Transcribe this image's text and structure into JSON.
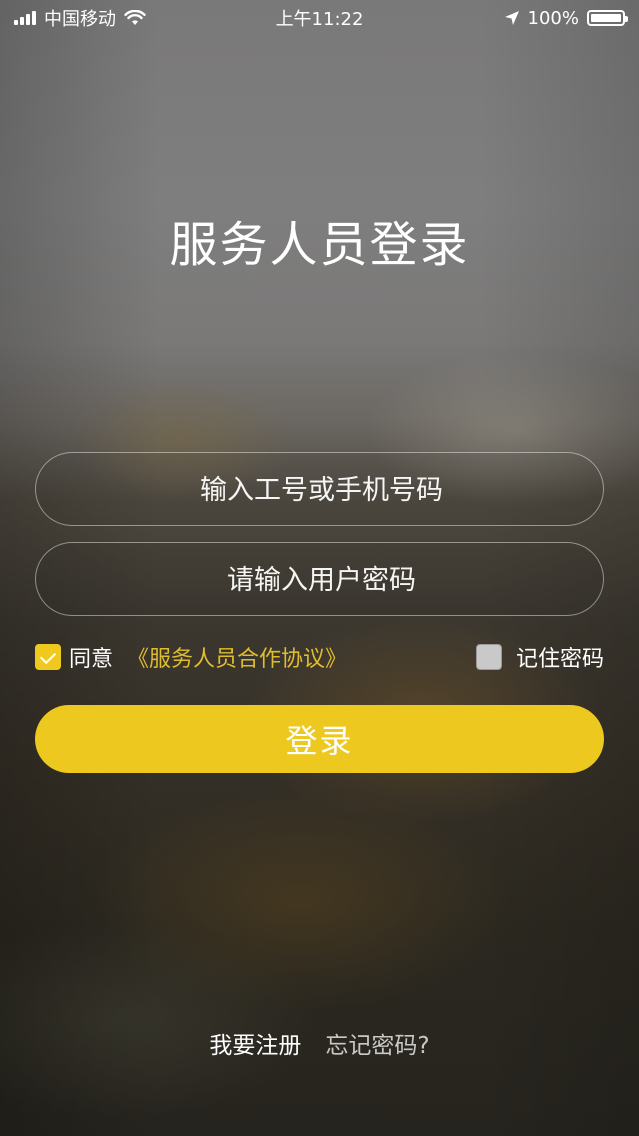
{
  "status_bar": {
    "carrier": "中国移动",
    "time": "上午11:22",
    "battery": "100%",
    "signal_icon": "signal-bars-icon",
    "wifi_icon": "wifi-icon",
    "location_icon": "location-arrow-icon",
    "battery_icon": "battery-icon",
    "battery_level": 1.0
  },
  "title": "服务人员登录",
  "form": {
    "username": {
      "placeholder": "输入工号或手机号码",
      "value": ""
    },
    "password": {
      "placeholder": "请输入用户密码",
      "value": ""
    },
    "agree": {
      "checked": true,
      "label": "同意",
      "link": "《服务人员合作协议》"
    },
    "remember": {
      "checked": false,
      "label": "记住密码"
    },
    "login_label": "登录"
  },
  "footer": {
    "register": "我要注册",
    "forgot": "忘记密码?"
  },
  "colors": {
    "accent": "#edc920",
    "link": "#e0bd2e"
  }
}
